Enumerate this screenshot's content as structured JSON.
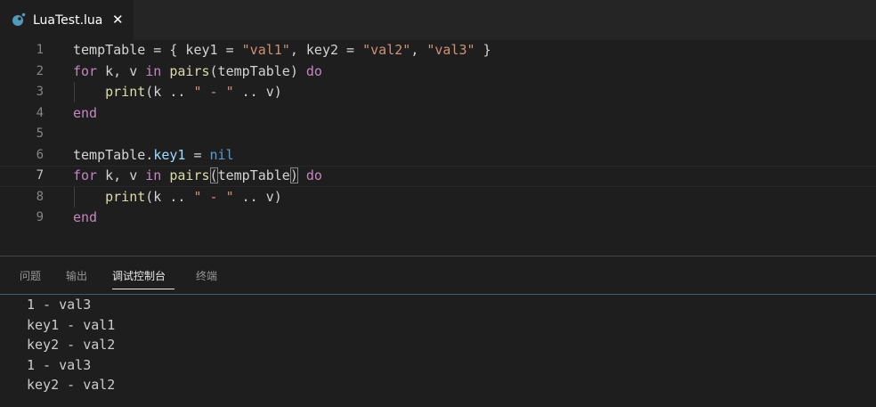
{
  "tab": {
    "label": "LuaTest.lua",
    "close": "✕",
    "icon": "lua-file-icon"
  },
  "editor": {
    "line_numbers": [
      "1",
      "2",
      "3",
      "4",
      "5",
      "6",
      "7",
      "8",
      "9"
    ],
    "active_line": 7
  },
  "code": {
    "l1": [
      "tempTable = { key1 = ",
      "\"val1\"",
      ", key2 = ",
      "\"val2\"",
      ", ",
      "\"val3\"",
      " }"
    ],
    "l2": [
      "for",
      " k, v ",
      "in",
      " ",
      "pairs",
      "(tempTable) ",
      "do"
    ],
    "l3": [
      "    ",
      "print",
      "(k .. ",
      "\" - \"",
      " .. v)"
    ],
    "l4": [
      "end"
    ],
    "l6": [
      "tempTable.",
      "key1",
      " = ",
      "nil"
    ],
    "l7": [
      "for",
      " k, v ",
      "in",
      " ",
      "pairs",
      "(",
      "tempTable",
      ")",
      " ",
      "do"
    ],
    "l8": [
      "    ",
      "print",
      "(k .. ",
      "\" - \"",
      " .. v)"
    ],
    "l9": [
      "end"
    ]
  },
  "panel": {
    "tabs": [
      "问题",
      "输出",
      "调试控制台",
      "终端"
    ],
    "active_tab": "调试控制台",
    "output": [
      "1 - val3",
      "key1 - val1",
      "key2 - val2",
      "1 - val3",
      "key2 - val2"
    ]
  },
  "colors": {
    "keyword": "#c586c0",
    "string": "#ce9178",
    "function": "#dcdcaa",
    "property": "#9cdcfe",
    "constant": "#569cd6",
    "text": "#d4d4d4",
    "background": "#1e1e1e",
    "lua_icon": "#519aba"
  }
}
